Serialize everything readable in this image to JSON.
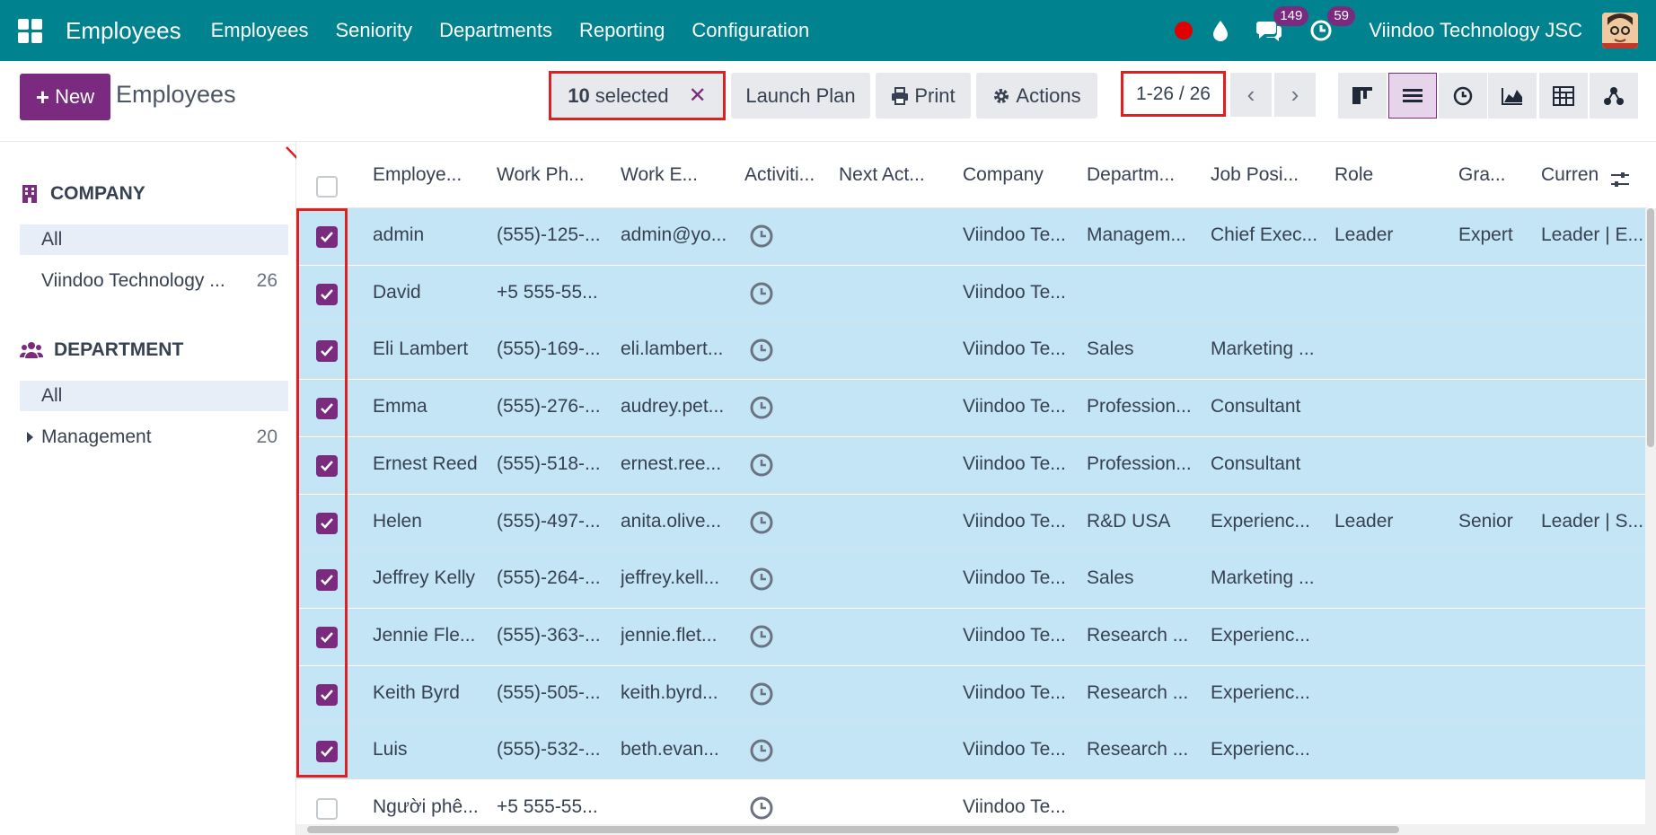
{
  "navbar": {
    "brand": "Employees",
    "menus": [
      "Employees",
      "Seniority",
      "Departments",
      "Reporting",
      "Configuration"
    ],
    "messages_badge": "149",
    "activities_badge": "59",
    "company": "Viindoo Technology JSC",
    "accent": "#00838f"
  },
  "control_panel": {
    "new_label": "New",
    "title": "Employees",
    "selected_count": "10",
    "selected_label": "selected",
    "launch_plan": "Launch Plan",
    "print": "Print",
    "actions": "Actions",
    "pager": "1-26 / 26",
    "brand_color": "#7a2b7f"
  },
  "sidebar": {
    "company_title": "COMPANY",
    "company_items": [
      {
        "label": "All",
        "count": ""
      },
      {
        "label": "Viindoo Technology ...",
        "count": "26"
      }
    ],
    "department_title": "DEPARTMENT",
    "department_items": [
      {
        "label": "All",
        "count": ""
      },
      {
        "label": "Management",
        "count": "20"
      }
    ]
  },
  "table": {
    "columns": [
      "Employe...",
      "Work Ph...",
      "Work E...",
      "Activiti...",
      "Next Act...",
      "Company",
      "Departm...",
      "Job Posi...",
      "Role",
      "Gra...",
      "Curren"
    ],
    "rows": [
      {
        "selected": true,
        "name": "admin",
        "phone": "(555)-125-...",
        "email": "admin@yo...",
        "company": "Viindoo Te...",
        "department": "Managem...",
        "job": "Chief Exec...",
        "role": "Leader",
        "grade": "Expert",
        "current": "Leader | E..."
      },
      {
        "selected": true,
        "name": "David",
        "phone": "+5 555-55...",
        "email": "",
        "company": "Viindoo Te...",
        "department": "",
        "job": "",
        "role": "",
        "grade": "",
        "current": ""
      },
      {
        "selected": true,
        "name": "Eli Lambert",
        "phone": "(555)-169-...",
        "email": "eli.lambert...",
        "company": "Viindoo Te...",
        "department": "Sales",
        "job": "Marketing ...",
        "role": "",
        "grade": "",
        "current": ""
      },
      {
        "selected": true,
        "name": "Emma",
        "phone": "(555)-276-...",
        "email": "audrey.pet...",
        "company": "Viindoo Te...",
        "department": "Profession...",
        "job": "Consultant",
        "role": "",
        "grade": "",
        "current": ""
      },
      {
        "selected": true,
        "name": "Ernest Reed",
        "phone": "(555)-518-...",
        "email": "ernest.ree...",
        "company": "Viindoo Te...",
        "department": "Profession...",
        "job": "Consultant",
        "role": "",
        "grade": "",
        "current": ""
      },
      {
        "selected": true,
        "name": "Helen",
        "phone": "(555)-497-...",
        "email": "anita.olive...",
        "company": "Viindoo Te...",
        "department": "R&D USA",
        "job": "Experienc...",
        "role": "Leader",
        "grade": "Senior",
        "current": "Leader | S..."
      },
      {
        "selected": true,
        "name": "Jeffrey Kelly",
        "phone": "(555)-264-...",
        "email": "jeffrey.kell...",
        "company": "Viindoo Te...",
        "department": "Sales",
        "job": "Marketing ...",
        "role": "",
        "grade": "",
        "current": ""
      },
      {
        "selected": true,
        "name": "Jennie Fle...",
        "phone": "(555)-363-...",
        "email": "jennie.flet...",
        "company": "Viindoo Te...",
        "department": "Research ...",
        "job": "Experienc...",
        "role": "",
        "grade": "",
        "current": ""
      },
      {
        "selected": true,
        "name": "Keith Byrd",
        "phone": "(555)-505-...",
        "email": "keith.byrd...",
        "company": "Viindoo Te...",
        "department": "Research ...",
        "job": "Experienc...",
        "role": "",
        "grade": "",
        "current": ""
      },
      {
        "selected": true,
        "name": "Luis",
        "phone": "(555)-532-...",
        "email": "beth.evan...",
        "company": "Viindoo Te...",
        "department": "Research ...",
        "job": "Experienc...",
        "role": "",
        "grade": "",
        "current": ""
      },
      {
        "selected": false,
        "name": "Người phê...",
        "phone": "+5 555-55...",
        "email": "",
        "company": "Viindoo Te...",
        "department": "",
        "job": "",
        "role": "",
        "grade": "",
        "current": ""
      }
    ],
    "selected_row_color": "#c4e5f5"
  }
}
